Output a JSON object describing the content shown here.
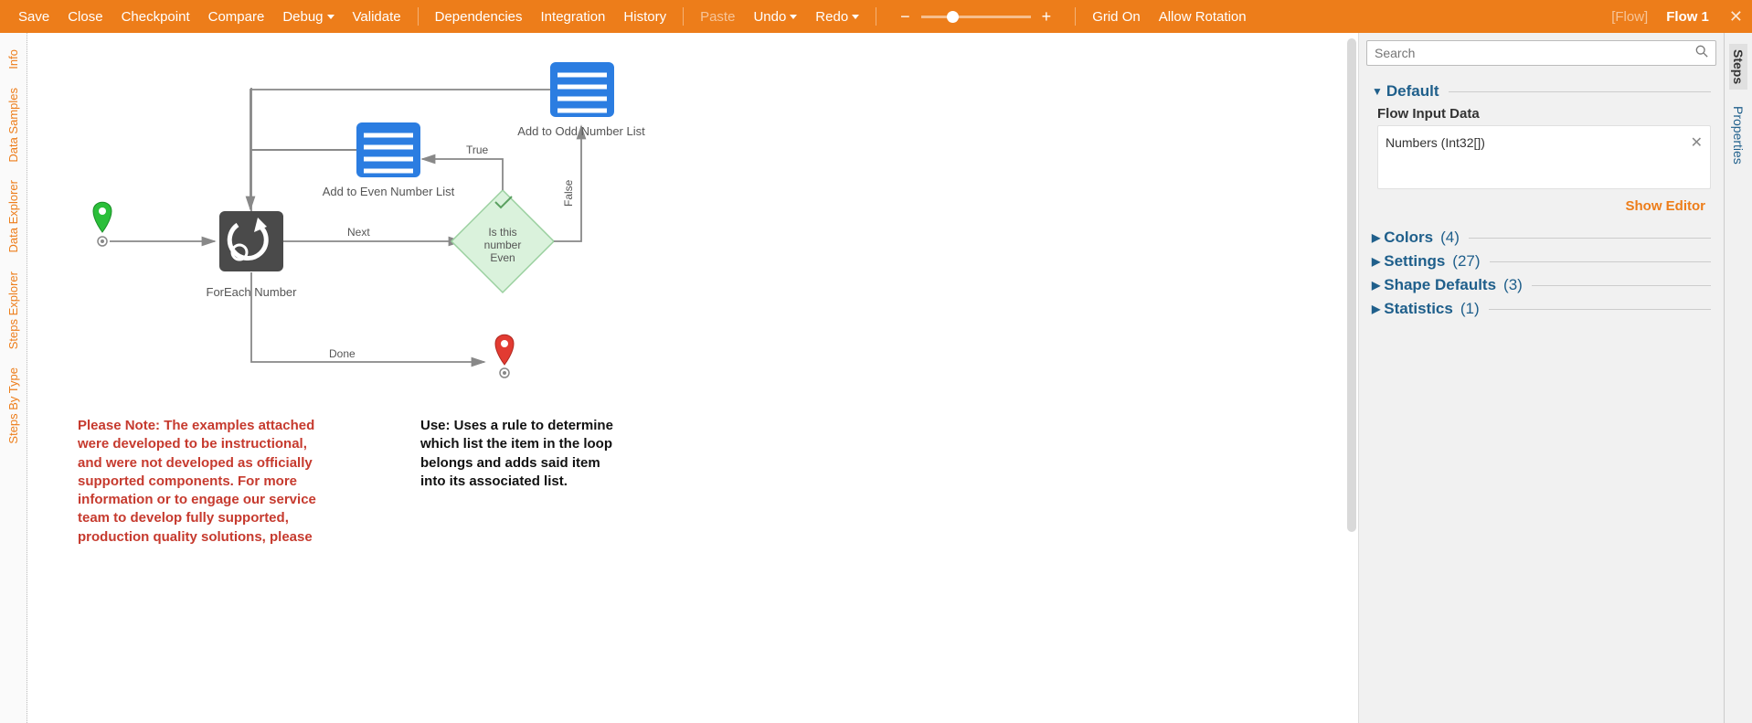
{
  "toolbar": {
    "save": "Save",
    "close": "Close",
    "checkpoint": "Checkpoint",
    "compare": "Compare",
    "debug": "Debug",
    "validate": "Validate",
    "dependencies": "Dependencies",
    "integration": "Integration",
    "history": "History",
    "paste": "Paste",
    "undo": "Undo",
    "redo": "Redo",
    "grid_on": "Grid On",
    "allow_rotation": "Allow Rotation",
    "flow_type": "[Flow]",
    "flow_name": "Flow 1"
  },
  "left_tabs": [
    "Info",
    "Data Samples",
    "Data Explorer",
    "Steps Explorer",
    "Steps By Type"
  ],
  "right_tabs": {
    "steps": "Steps",
    "properties": "Properties"
  },
  "search": {
    "placeholder": "Search"
  },
  "panel": {
    "default": "Default",
    "flow_input_label": "Flow Input Data",
    "input_item": "Numbers (Int32[])",
    "show_editor": "Show Editor",
    "sections": {
      "colors": {
        "label": "Colors",
        "count": "(4)"
      },
      "settings": {
        "label": "Settings",
        "count": "(27)"
      },
      "shape_defaults": {
        "label": "Shape Defaults",
        "count": "(3)"
      },
      "statistics": {
        "label": "Statistics",
        "count": "(1)"
      }
    }
  },
  "canvas": {
    "foreach": "ForEach Number",
    "even_list": "Add to Even Number List",
    "odd_list": "Add to Odd Number List",
    "decision1": "Is this",
    "decision2": "number",
    "decision3": "Even",
    "edge_next": "Next",
    "edge_done": "Done",
    "edge_true": "True",
    "edge_false": "False"
  },
  "notes": {
    "red": "Please Note: The examples attached were developed to be instructional, and were not developed as officially supported components.  For more information or to engage our service team to develop fully supported, production quality solutions, please",
    "black": "Use: Uses a rule to determine which list the item in the loop belongs and adds said item into its associated list."
  }
}
